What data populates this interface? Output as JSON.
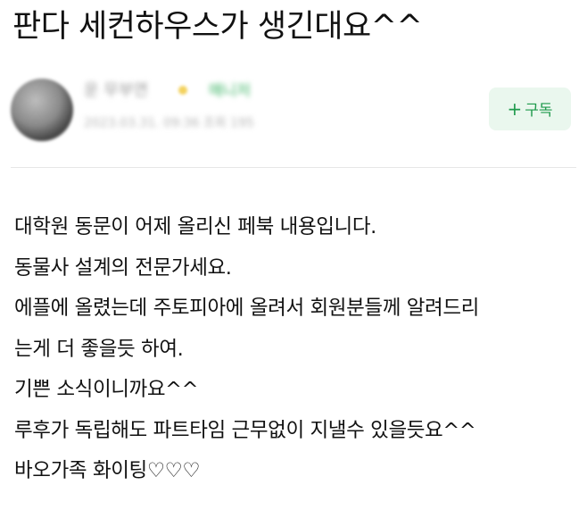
{
  "post": {
    "title": "판다 세컨하우스가 생긴대요^^"
  },
  "author": {
    "name": "운 무부연",
    "badge": "매니저",
    "meta": "2023.03.31. 09:36  조회 195"
  },
  "subscribe": {
    "icon": "plus-icon",
    "plus_symbol": "+",
    "label": "구독",
    "color": "#1f9a4c",
    "background": "#eaf7ee"
  },
  "content": {
    "lines": [
      "대학원 동문이 어제 올리신 페북 내용입니다.",
      "동물사 설계의 전문가세요.",
      "에플에 올렸는데 주토피아에 올려서 회원분들께 알려드리",
      "는게 더 좋을듯 하여.",
      "기쁜 소식이니까요^^",
      "루후가 독립해도 파트타임 근무없이 지낼수 있을듯요^^",
      "바오가족 화이팅♡♡♡"
    ]
  }
}
